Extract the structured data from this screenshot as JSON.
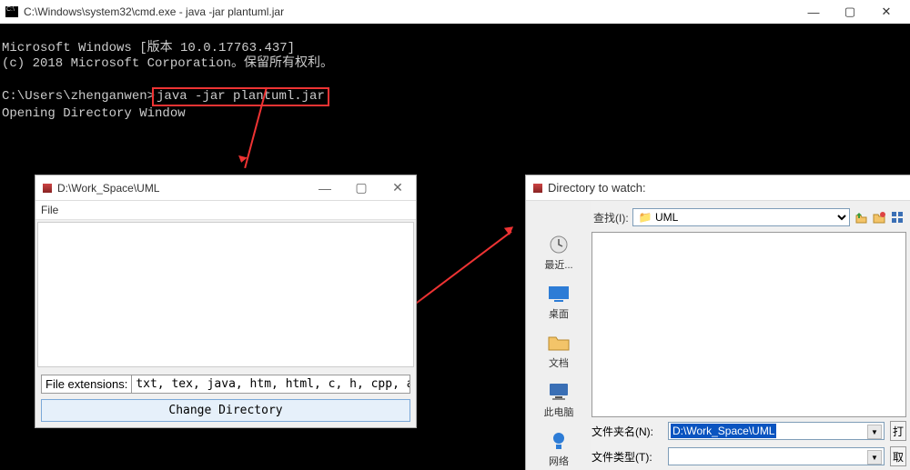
{
  "cmd": {
    "title": "C:\\Windows\\system32\\cmd.exe - java  -jar plantuml.jar",
    "lines": {
      "l1": "Microsoft Windows [版本 10.0.17763.437]",
      "l2": "(c) 2018 Microsoft Corporation。保留所有权利。",
      "prompt": "C:\\Users\\zhenganwen>",
      "command": "java -jar plantuml.jar",
      "l4": "Opening Directory Window"
    }
  },
  "uml": {
    "title": "D:\\Work_Space\\UML",
    "menu_file": "File",
    "ext_label": "File extensions:",
    "ext_value": "txt, tex, java, htm, html, c, h, cpp, apt, pu,",
    "change_dir": "Change Directory"
  },
  "dir": {
    "title": "Directory to watch:",
    "lookin_label": "查找(I):",
    "lookin_value": "UML",
    "places": {
      "recent": "最近...",
      "desktop": "桌面",
      "documents": "文档",
      "thispc": "此电脑",
      "network": "网络"
    },
    "folder_label": "文件夹名(N):",
    "folder_value": "D:\\Work_Space\\UML",
    "type_label": "文件类型(T):",
    "type_value": "",
    "open_btn": "打",
    "cancel_btn": "取"
  }
}
